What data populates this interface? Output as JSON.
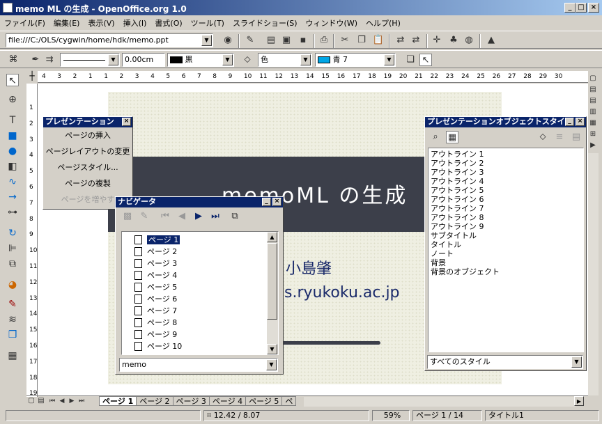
{
  "window": {
    "title": "memo ML の生成 - OpenOffice.org 1.0",
    "controls": {
      "minimize": "_",
      "maximize": "□",
      "close": "×"
    }
  },
  "menu": [
    "ファイル(F)",
    "編集(E)",
    "表示(V)",
    "挿入(I)",
    "書式(O)",
    "ツール(T)",
    "スライドショー(S)",
    "ウィンドウ(W)",
    "ヘルプ(H)"
  ],
  "toolbar": {
    "url": "file:///C:/OLS/cygwin/home/hdk/memo.ppt"
  },
  "format_bar": {
    "line_width": "0.00cm",
    "line_color": "黒",
    "area_style": "色",
    "area_color": "青 7",
    "colors": {
      "line_swatch": "#000000",
      "area_swatch": "#00a6e6"
    }
  },
  "ruler": {
    "h_ticks": [
      "4",
      "3",
      "2",
      "1",
      "1",
      "2",
      "3",
      "4",
      "5",
      "6",
      "7",
      "8",
      "9",
      "10",
      "11",
      "12",
      "13",
      "14",
      "15",
      "16",
      "17",
      "18",
      "19",
      "20",
      "21",
      "22",
      "23",
      "24",
      "25",
      "26",
      "27",
      "28",
      "29",
      "30"
    ],
    "v_ticks": [
      "1",
      "2",
      "3",
      "4",
      "5",
      "6",
      "7",
      "8",
      "9",
      "10",
      "11",
      "12",
      "13",
      "14",
      "15",
      "16",
      "17",
      "18",
      "19"
    ]
  },
  "slide": {
    "title": "memoML の生成",
    "author": "小島肇",
    "email": "s.ryukoku.ac.jp"
  },
  "presentation_panel": {
    "title": "プレゼンテーション",
    "items": [
      "ページの挿入",
      "ページレイアウトの変更",
      "ページスタイル...",
      "ページの複製",
      "ページを増やす"
    ]
  },
  "navigator": {
    "title": "ナビゲータ",
    "pages": [
      "ページ 1",
      "ページ 2",
      "ページ 3",
      "ページ 4",
      "ページ 5",
      "ページ 6",
      "ページ 7",
      "ページ 8",
      "ページ 9",
      "ページ 10"
    ],
    "document": "memo"
  },
  "styles_panel": {
    "title": "プレゼンテーションオブジェクトスタイル",
    "styles": [
      "アウトライン 1",
      "アウトライン 2",
      "アウトライン 3",
      "アウトライン 4",
      "アウトライン 5",
      "アウトライン 6",
      "アウトライン 7",
      "アウトライン 8",
      "アウトライン 9",
      "サブタイトル",
      "タイトル",
      "ノート",
      "背景",
      "背景のオブジェクト"
    ],
    "filter": "すべてのスタイル"
  },
  "page_tabs": [
    "ページ 1",
    "ページ 2",
    "ページ 3",
    "ページ 4",
    "ページ 5",
    "ペ"
  ],
  "status": {
    "position": "12.42 / 8.07",
    "zoom": "59%",
    "page": "ページ 1 / 14",
    "layout": "タイトル1"
  }
}
